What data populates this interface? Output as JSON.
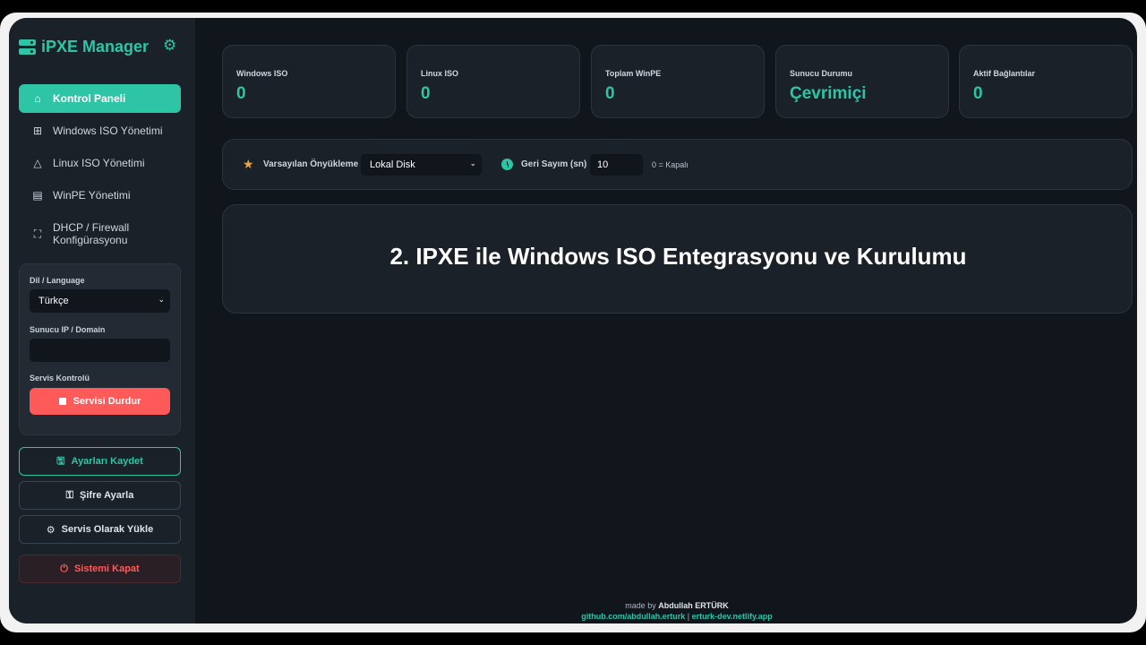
{
  "brand": {
    "title": "iPXE Manager",
    "logo_icon": "server-icon",
    "settings_icon": "gear-icon"
  },
  "nav": [
    {
      "label": "Kontrol Paneli",
      "icon": "home-icon",
      "active": true
    },
    {
      "label": "Windows ISO Yönetimi",
      "icon": "windows-icon"
    },
    {
      "label": "Linux ISO Yönetimi",
      "icon": "linux-icon"
    },
    {
      "label": "WinPE Yönetimi",
      "icon": "server-icon"
    },
    {
      "label": "DHCP / Firewall Konfigürasyonu",
      "icon": "network-icon"
    }
  ],
  "settings": {
    "language_label": "Dil / Language",
    "language_value": "Türkçe",
    "server_label": "Sunucu IP / Domain",
    "server_value": "",
    "service_label": "Servis Kontrolü",
    "stop_button": "Servisi Durdur"
  },
  "actions": {
    "save": "Ayarları Kaydet",
    "password": "Şifre Ayarla",
    "install_service": "Servis Olarak Yükle",
    "shutdown": "Sistemi Kapat"
  },
  "stats": [
    {
      "label": "Windows ISO",
      "value": "0"
    },
    {
      "label": "Linux ISO",
      "value": "0"
    },
    {
      "label": "Toplam WinPE",
      "value": "0"
    },
    {
      "label": "Sunucu Durumu",
      "value": "Çevrimiçi"
    },
    {
      "label": "Aktif Bağlantılar",
      "value": "0"
    }
  ],
  "boot": {
    "default_label": "Varsayılan Önyükleme",
    "default_value": "Lokal Disk",
    "countdown_label": "Geri Sayım (sn)",
    "countdown_value": "10",
    "countdown_hint": "0 = Kapalı"
  },
  "overlay_title": "2. IPXE ile Windows ISO Entegrasyonu ve Kurulumu",
  "footer": {
    "made_by_prefix": "made by",
    "author": "Abdullah ERTÜRK",
    "github": "github.com/abdullah.erturk",
    "separator": "|",
    "site": "erturk-dev.netlify.app"
  },
  "colors": {
    "accent": "#2ec4a6",
    "danger": "#ff5a5a",
    "warning": "#f0a43a",
    "background": "#11151c",
    "panel": "#1b2129"
  }
}
